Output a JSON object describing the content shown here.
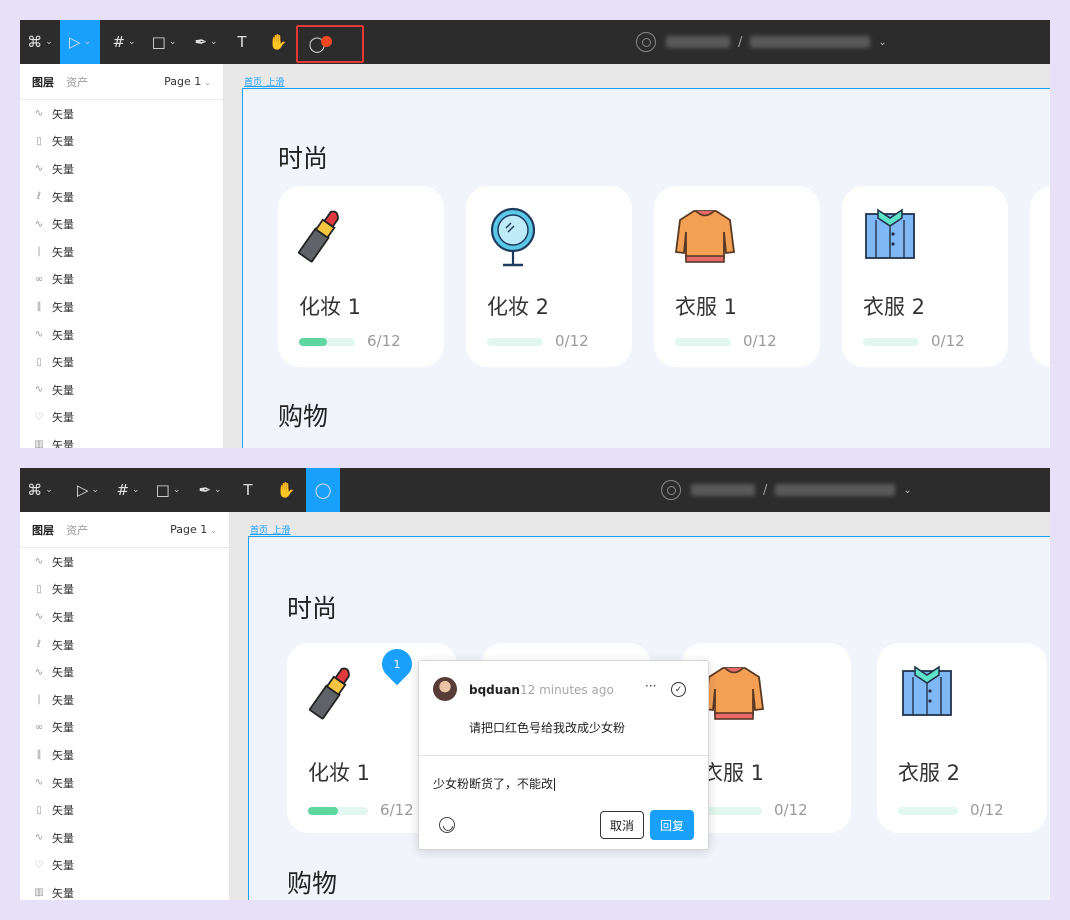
{
  "toolbar": {
    "tools": [
      {
        "icon": "figma-menu-icon",
        "glyph": "⌘"
      },
      {
        "icon": "move-tool-icon",
        "glyph": "▷"
      },
      {
        "icon": "frame-tool-icon",
        "glyph": "#"
      },
      {
        "icon": "shape-tool-icon",
        "glyph": "□"
      },
      {
        "icon": "pen-tool-icon",
        "glyph": "✒"
      },
      {
        "icon": "text-tool-icon",
        "glyph": "T"
      },
      {
        "icon": "hand-tool-icon",
        "glyph": "✋"
      },
      {
        "icon": "comment-tool-icon",
        "glyph": "◯"
      }
    ],
    "chevron": "⌄",
    "slash": "/",
    "menu_chevron": "⌄"
  },
  "layers_panel": {
    "tab_layers": "图层",
    "tab_assets": "资产",
    "page_label": "Page 1",
    "page_chevron": "⌄",
    "items": [
      {
        "icon": "vector-icon",
        "glyph": "∿",
        "label": "矢量"
      },
      {
        "icon": "vector-icon",
        "glyph": "▯",
        "label": "矢量"
      },
      {
        "icon": "vector-icon",
        "glyph": "∿",
        "label": "矢量"
      },
      {
        "icon": "vector-icon",
        "glyph": "ℓ",
        "label": "矢量"
      },
      {
        "icon": "vector-icon",
        "glyph": "∿",
        "label": "矢量"
      },
      {
        "icon": "vector-icon",
        "glyph": "|",
        "label": "矢量"
      },
      {
        "icon": "vector-icon",
        "glyph": "∞",
        "label": "矢量"
      },
      {
        "icon": "vector-icon",
        "glyph": "‖",
        "label": "矢量"
      },
      {
        "icon": "vector-icon",
        "glyph": "∿",
        "label": "矢量"
      },
      {
        "icon": "vector-icon",
        "glyph": "▯",
        "label": "矢量"
      },
      {
        "icon": "vector-icon",
        "glyph": "∿",
        "label": "矢量"
      },
      {
        "icon": "vector-icon",
        "glyph": "♡",
        "label": "矢量"
      },
      {
        "icon": "vector-icon",
        "glyph": "▥",
        "label": "矢量"
      }
    ]
  },
  "canvas": {
    "frame_label": "首页_上滑",
    "section_fashion": "时尚",
    "section_shopping": "购物",
    "cards": [
      {
        "name": "化妆 1",
        "progress_text": "6/12",
        "progress": 0.5,
        "icon": "lipstick-icon"
      },
      {
        "name": "化妆 2",
        "progress_text": "0/12",
        "progress": 0,
        "icon": "mirror-icon"
      },
      {
        "name": "衣服 1",
        "progress_text": "0/12",
        "progress": 0,
        "icon": "sweater-icon"
      },
      {
        "name": "衣服 2",
        "progress_text": "0/12",
        "progress": 0,
        "icon": "shirt-icon"
      }
    ]
  },
  "comment": {
    "pin_number": "1",
    "username": "bqduan",
    "time": "12 minutes ago",
    "more": "···",
    "resolve": "✓",
    "message": "请把口红色号给我改成少女粉",
    "reply_text": "少女粉断货了，不能改",
    "cancel_label": "取消",
    "reply_label": "回复"
  },
  "colors": {
    "accent": "#18a0fb",
    "toolbar_bg": "#2c2c2c",
    "progress_fill": "#5ed6a0",
    "progress_track": "#e2f7ef",
    "highlight_red": "#e53935",
    "notification_dot": "#f24822"
  }
}
